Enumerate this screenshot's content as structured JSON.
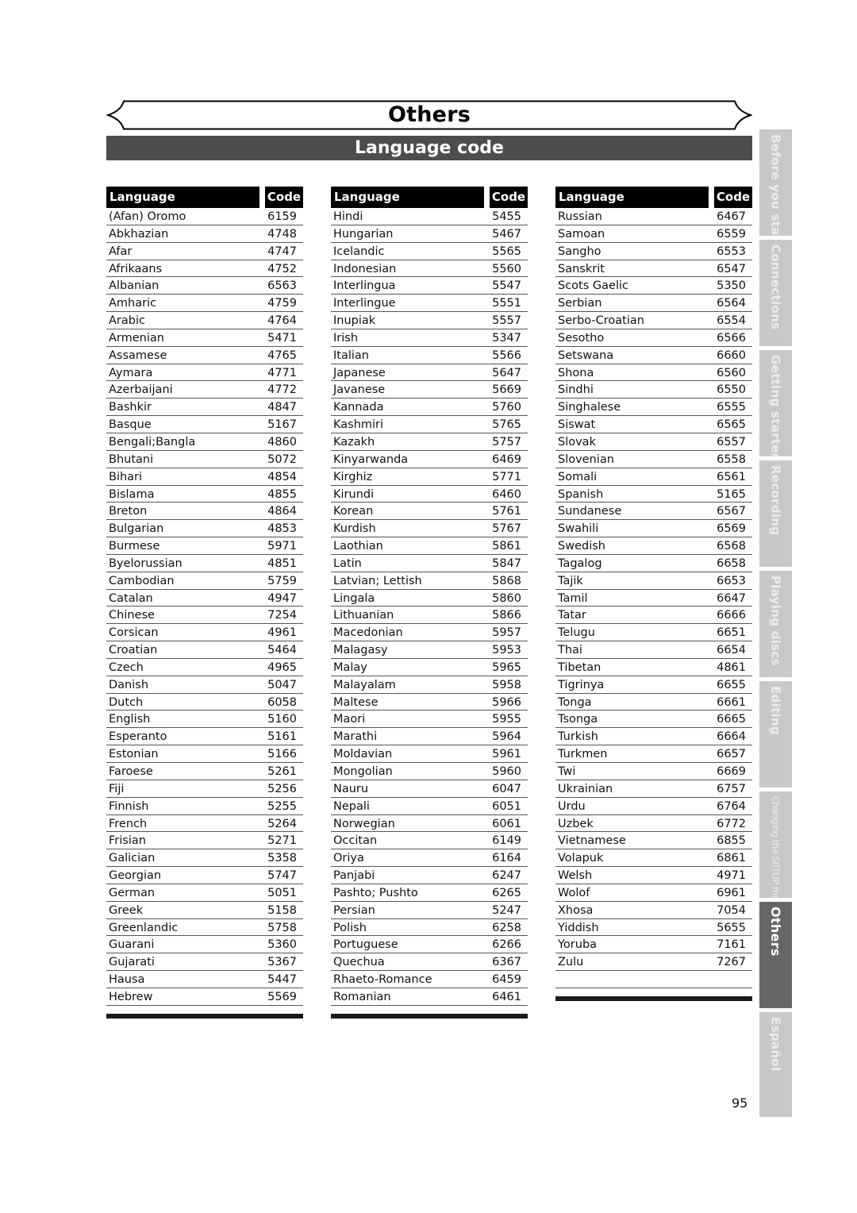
{
  "header": {
    "title": "Others",
    "subtitle": "Language code"
  },
  "table_headers": {
    "language": "Language",
    "code": "Code"
  },
  "columns": [
    [
      {
        "language": "(Afan) Oromo",
        "code": "6159"
      },
      {
        "language": "Abkhazian",
        "code": "4748"
      },
      {
        "language": "Afar",
        "code": "4747"
      },
      {
        "language": "Afrikaans",
        "code": "4752"
      },
      {
        "language": "Albanian",
        "code": "6563"
      },
      {
        "language": "Amharic",
        "code": "4759"
      },
      {
        "language": "Arabic",
        "code": "4764"
      },
      {
        "language": "Armenian",
        "code": "5471"
      },
      {
        "language": "Assamese",
        "code": "4765"
      },
      {
        "language": "Aymara",
        "code": "4771"
      },
      {
        "language": "Azerbaijani",
        "code": "4772"
      },
      {
        "language": "Bashkir",
        "code": "4847"
      },
      {
        "language": "Basque",
        "code": "5167"
      },
      {
        "language": "Bengali;Bangla",
        "code": "4860"
      },
      {
        "language": "Bhutani",
        "code": "5072"
      },
      {
        "language": "Bihari",
        "code": "4854"
      },
      {
        "language": "Bislama",
        "code": "4855"
      },
      {
        "language": "Breton",
        "code": "4864"
      },
      {
        "language": "Bulgarian",
        "code": "4853"
      },
      {
        "language": "Burmese",
        "code": "5971"
      },
      {
        "language": "Byelorussian",
        "code": "4851"
      },
      {
        "language": "Cambodian",
        "code": "5759"
      },
      {
        "language": "Catalan",
        "code": "4947"
      },
      {
        "language": "Chinese",
        "code": "7254"
      },
      {
        "language": "Corsican",
        "code": "4961"
      },
      {
        "language": "Croatian",
        "code": "5464"
      },
      {
        "language": "Czech",
        "code": "4965"
      },
      {
        "language": "Danish",
        "code": "5047"
      },
      {
        "language": "Dutch",
        "code": "6058"
      },
      {
        "language": "English",
        "code": "5160"
      },
      {
        "language": "Esperanto",
        "code": "5161"
      },
      {
        "language": "Estonian",
        "code": "5166"
      },
      {
        "language": "Faroese",
        "code": "5261"
      },
      {
        "language": "Fiji",
        "code": "5256"
      },
      {
        "language": "Finnish",
        "code": "5255"
      },
      {
        "language": "French",
        "code": "5264"
      },
      {
        "language": "Frisian",
        "code": "5271"
      },
      {
        "language": "Galician",
        "code": "5358"
      },
      {
        "language": "Georgian",
        "code": "5747"
      },
      {
        "language": "German",
        "code": "5051"
      },
      {
        "language": "Greek",
        "code": "5158"
      },
      {
        "language": "Greenlandic",
        "code": "5758"
      },
      {
        "language": "Guarani",
        "code": "5360"
      },
      {
        "language": "Gujarati",
        "code": "5367"
      },
      {
        "language": "Hausa",
        "code": "5447"
      },
      {
        "language": "Hebrew",
        "code": "5569"
      }
    ],
    [
      {
        "language": "Hindi",
        "code": "5455"
      },
      {
        "language": "Hungarian",
        "code": "5467"
      },
      {
        "language": "Icelandic",
        "code": "5565"
      },
      {
        "language": "Indonesian",
        "code": "5560"
      },
      {
        "language": "Interlingua",
        "code": "5547"
      },
      {
        "language": "Interlingue",
        "code": "5551"
      },
      {
        "language": "Inupiak",
        "code": "5557"
      },
      {
        "language": "Irish",
        "code": "5347"
      },
      {
        "language": "Italian",
        "code": "5566"
      },
      {
        "language": "Japanese",
        "code": "5647"
      },
      {
        "language": "Javanese",
        "code": "5669"
      },
      {
        "language": "Kannada",
        "code": "5760"
      },
      {
        "language": "Kashmiri",
        "code": "5765"
      },
      {
        "language": "Kazakh",
        "code": "5757"
      },
      {
        "language": "Kinyarwanda",
        "code": "6469"
      },
      {
        "language": "Kirghiz",
        "code": "5771"
      },
      {
        "language": "Kirundi",
        "code": "6460"
      },
      {
        "language": "Korean",
        "code": "5761"
      },
      {
        "language": "Kurdish",
        "code": "5767"
      },
      {
        "language": "Laothian",
        "code": "5861"
      },
      {
        "language": "Latin",
        "code": "5847"
      },
      {
        "language": "Latvian; Lettish",
        "code": "5868"
      },
      {
        "language": "Lingala",
        "code": "5860"
      },
      {
        "language": "Lithuanian",
        "code": "5866"
      },
      {
        "language": "Macedonian",
        "code": "5957"
      },
      {
        "language": "Malagasy",
        "code": "5953"
      },
      {
        "language": "Malay",
        "code": "5965"
      },
      {
        "language": "Malayalam",
        "code": "5958"
      },
      {
        "language": "Maltese",
        "code": "5966"
      },
      {
        "language": "Maori",
        "code": "5955"
      },
      {
        "language": "Marathi",
        "code": "5964"
      },
      {
        "language": "Moldavian",
        "code": "5961"
      },
      {
        "language": "Mongolian",
        "code": "5960"
      },
      {
        "language": "Nauru",
        "code": "6047"
      },
      {
        "language": "Nepali",
        "code": "6051"
      },
      {
        "language": "Norwegian",
        "code": "6061"
      },
      {
        "language": "Occitan",
        "code": "6149"
      },
      {
        "language": "Oriya",
        "code": "6164"
      },
      {
        "language": "Panjabi",
        "code": "6247"
      },
      {
        "language": "Pashto; Pushto",
        "code": "6265"
      },
      {
        "language": "Persian",
        "code": "5247"
      },
      {
        "language": "Polish",
        "code": "6258"
      },
      {
        "language": "Portuguese",
        "code": "6266"
      },
      {
        "language": "Quechua",
        "code": "6367"
      },
      {
        "language": "Rhaeto-Romance",
        "code": "6459"
      },
      {
        "language": "Romanian",
        "code": "6461"
      }
    ],
    [
      {
        "language": "Russian",
        "code": "6467"
      },
      {
        "language": "Samoan",
        "code": "6559"
      },
      {
        "language": "Sangho",
        "code": "6553"
      },
      {
        "language": "Sanskrit",
        "code": "6547"
      },
      {
        "language": "Scots Gaelic",
        "code": "5350"
      },
      {
        "language": "Serbian",
        "code": "6564"
      },
      {
        "language": "Serbo-Croatian",
        "code": "6554"
      },
      {
        "language": "Sesotho",
        "code": "6566"
      },
      {
        "language": "Setswana",
        "code": "6660"
      },
      {
        "language": "Shona",
        "code": "6560"
      },
      {
        "language": "Sindhi",
        "code": "6550"
      },
      {
        "language": "Singhalese",
        "code": "6555"
      },
      {
        "language": "Siswat",
        "code": "6565"
      },
      {
        "language": "Slovak",
        "code": "6557"
      },
      {
        "language": "Slovenian",
        "code": "6558"
      },
      {
        "language": "Somali",
        "code": "6561"
      },
      {
        "language": "Spanish",
        "code": "5165"
      },
      {
        "language": "Sundanese",
        "code": "6567"
      },
      {
        "language": "Swahili",
        "code": "6569"
      },
      {
        "language": "Swedish",
        "code": "6568"
      },
      {
        "language": "Tagalog",
        "code": "6658"
      },
      {
        "language": "Tajik",
        "code": "6653"
      },
      {
        "language": "Tamil",
        "code": "6647"
      },
      {
        "language": "Tatar",
        "code": "6666"
      },
      {
        "language": "Telugu",
        "code": "6651"
      },
      {
        "language": "Thai",
        "code": "6654"
      },
      {
        "language": "Tibetan",
        "code": "4861"
      },
      {
        "language": "Tigrinya",
        "code": "6655"
      },
      {
        "language": "Tonga",
        "code": "6661"
      },
      {
        "language": "Tsonga",
        "code": "6665"
      },
      {
        "language": "Turkish",
        "code": "6664"
      },
      {
        "language": "Turkmen",
        "code": "6657"
      },
      {
        "language": "Twi",
        "code": "6669"
      },
      {
        "language": "Ukrainian",
        "code": "6757"
      },
      {
        "language": "Urdu",
        "code": "6764"
      },
      {
        "language": "Uzbek",
        "code": "6772"
      },
      {
        "language": "Vietnamese",
        "code": "6855"
      },
      {
        "language": "Volapuk",
        "code": "6861"
      },
      {
        "language": "Welsh",
        "code": "4971"
      },
      {
        "language": "Wolof",
        "code": "6961"
      },
      {
        "language": "Xhosa",
        "code": "7054"
      },
      {
        "language": "Yiddish",
        "code": "5655"
      },
      {
        "language": "Yoruba",
        "code": "7161"
      },
      {
        "language": "Zulu",
        "code": "7267"
      }
    ]
  ],
  "side_tabs": [
    {
      "label": "Before you start",
      "active": false
    },
    {
      "label": "Connections",
      "active": false
    },
    {
      "label": "Getting started",
      "active": false
    },
    {
      "label": "Recording",
      "active": false
    },
    {
      "label": "Playing discs",
      "active": false
    },
    {
      "label": "Editing",
      "active": false
    },
    {
      "label": "Changing the SETUP menu",
      "active": false
    },
    {
      "label": "Others",
      "active": true
    },
    {
      "label": "Español",
      "active": false
    }
  ],
  "page_number": "95",
  "colors": {
    "subbar": "#4d4d4d",
    "header_cell": "#000000",
    "tab_inactive": "#c8c8c8",
    "tab_active": "#666666"
  }
}
